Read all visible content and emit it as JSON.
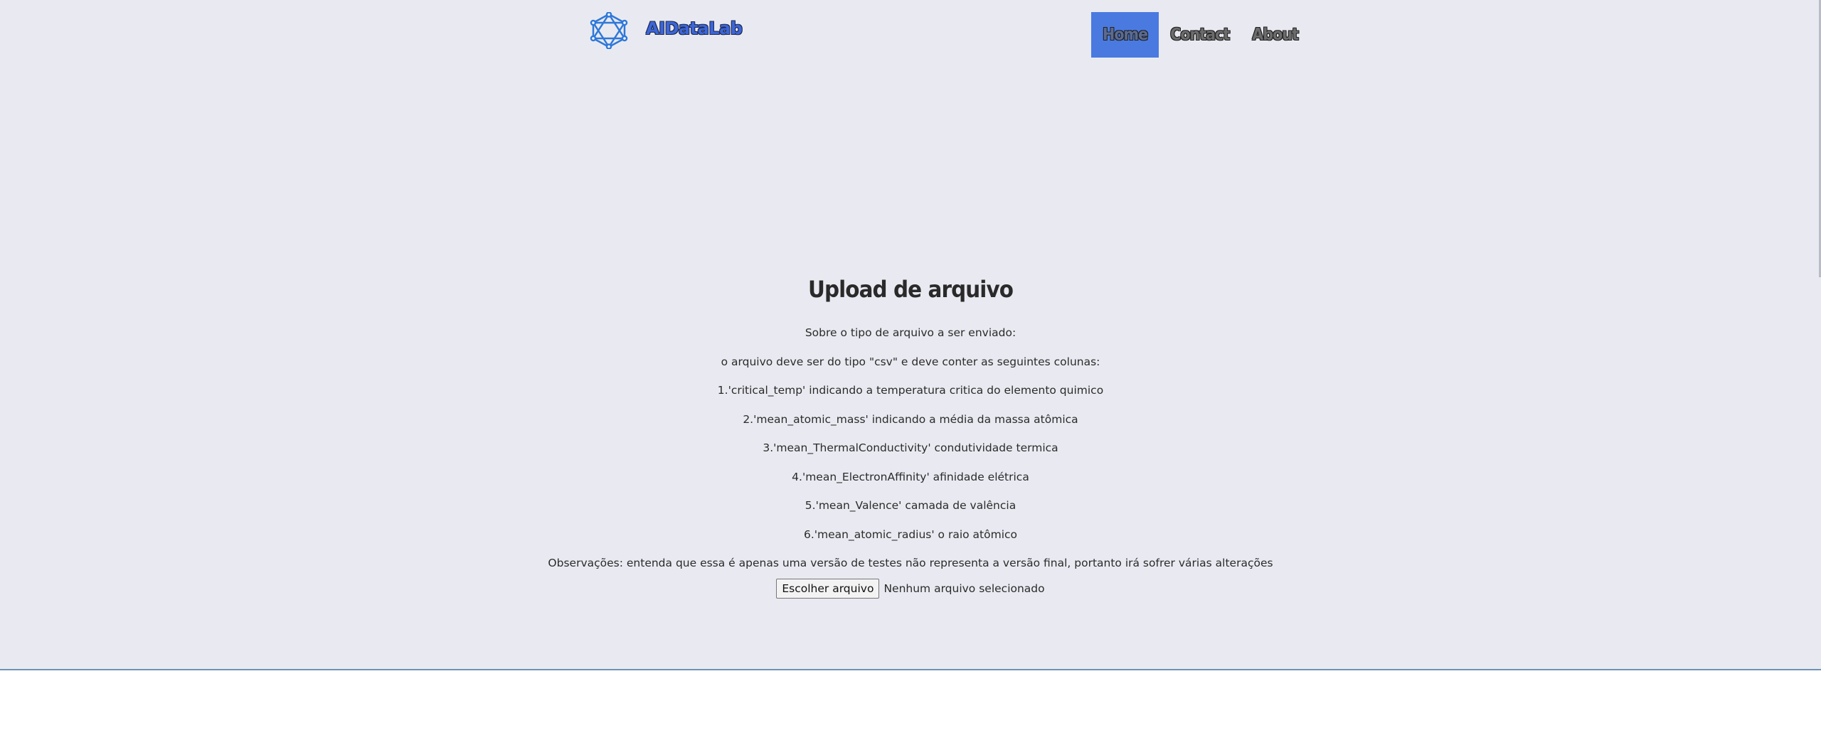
{
  "header": {
    "brand_name": "AIDataLab",
    "logo_icon": "network-icon",
    "brand_color": "#3d66d6"
  },
  "nav": {
    "items": [
      {
        "label": "Home",
        "active": true
      },
      {
        "label": "Contact",
        "active": false
      },
      {
        "label": "About",
        "active": false
      }
    ],
    "active_color": "#4a7ae0"
  },
  "main": {
    "title": "Upload de arquivo",
    "lines": [
      "Sobre o tipo de arquivo a ser enviado:",
      "o arquivo deve ser do tipo \"csv\" e deve conter as seguintes colunas:",
      "1.'critical_temp' indicando a temperatura critica do elemento quimico",
      "2.'mean_atomic_mass' indicando a média da massa atômica",
      "3.'mean_ThermalConductivity' condutividade termica",
      "4.'mean_ElectronAffinity' afinidade elétrica",
      "5.'mean_Valence' camada de valência",
      "6.'mean_atomic_radius' o raio atômico",
      "Observações: entenda que essa é apenas uma versão de testes não representa a versão final, portanto irá sofrer várias alterações"
    ],
    "file_input": {
      "button_label": "Escolher arquivo",
      "status": "Nenhum arquivo selecionado"
    }
  },
  "colors": {
    "page_background": "#e9eaf1",
    "footer_border": "#6c93b8"
  }
}
